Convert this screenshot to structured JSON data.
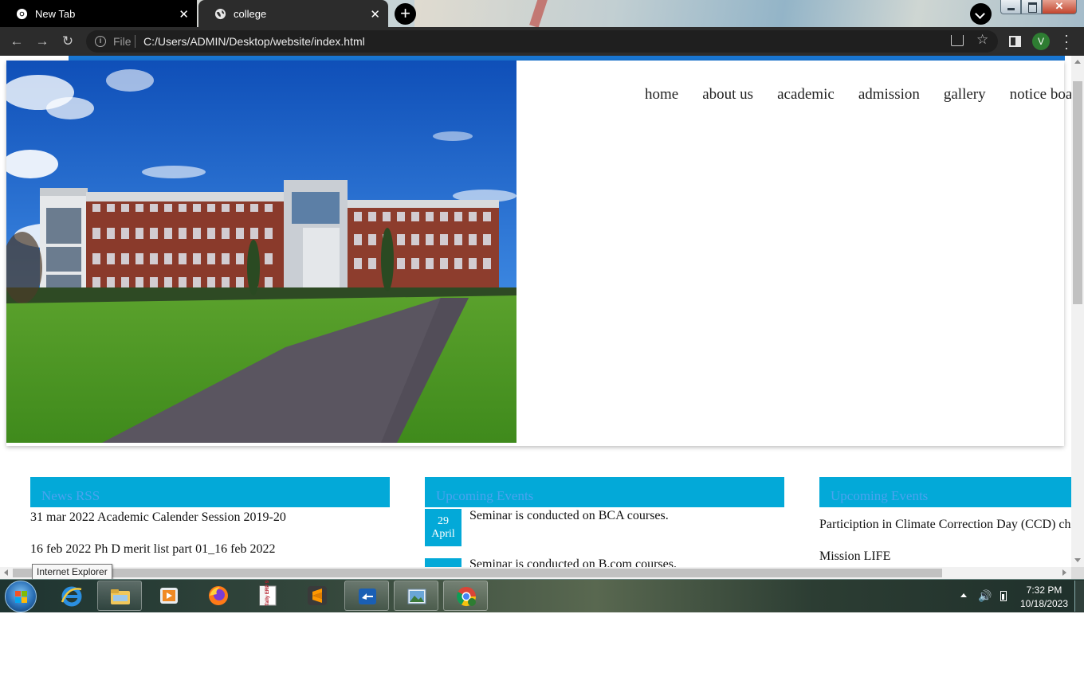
{
  "browser": {
    "tabs": [
      {
        "title": "New Tab",
        "active": false
      },
      {
        "title": "college",
        "active": true
      }
    ],
    "address": {
      "scheme_label": "File",
      "url": "C:/Users/ADMIN/Desktop/website/index.html"
    },
    "profile_initial": "V",
    "colors": {
      "accent_line": "#1976d2",
      "panel_header": "#03a9d8",
      "chrome_dark": "#2c2c2c"
    }
  },
  "page": {
    "nav": [
      "home",
      "about us",
      "academic",
      "admission",
      "gallery",
      "notice board"
    ],
    "panels": {
      "news": {
        "title": "News RSS",
        "items": [
          "31 mar 2022 Academic Calender Session 2019-20",
          "16 feb 2022 Ph D merit list part 01_16 feb 2022"
        ]
      },
      "upcoming": {
        "title": "Upcoming Events",
        "events": [
          {
            "day": "29",
            "month": "April",
            "text": "Seminar is conducted on BCA courses."
          },
          {
            "day": "",
            "month": "",
            "text": "Seminar is conducted on B.com courses."
          }
        ]
      },
      "upcoming2": {
        "title": "Upcoming Events",
        "items": [
          "Particiption in Climate Correction Day (CCD) challenge",
          "Mission LIFE"
        ]
      }
    }
  },
  "tooltip": "Internet Explorer",
  "taskbar": {
    "apps": [
      "internet-explorer",
      "file-explorer",
      "media-player",
      "firefox",
      "tally-erp9",
      "sublime-text",
      "teamviewer",
      "photo-viewer",
      "chrome"
    ],
    "tally_label": "Tally ERP 9",
    "clock": {
      "time": "7:32 PM",
      "date": "10/18/2023"
    }
  }
}
